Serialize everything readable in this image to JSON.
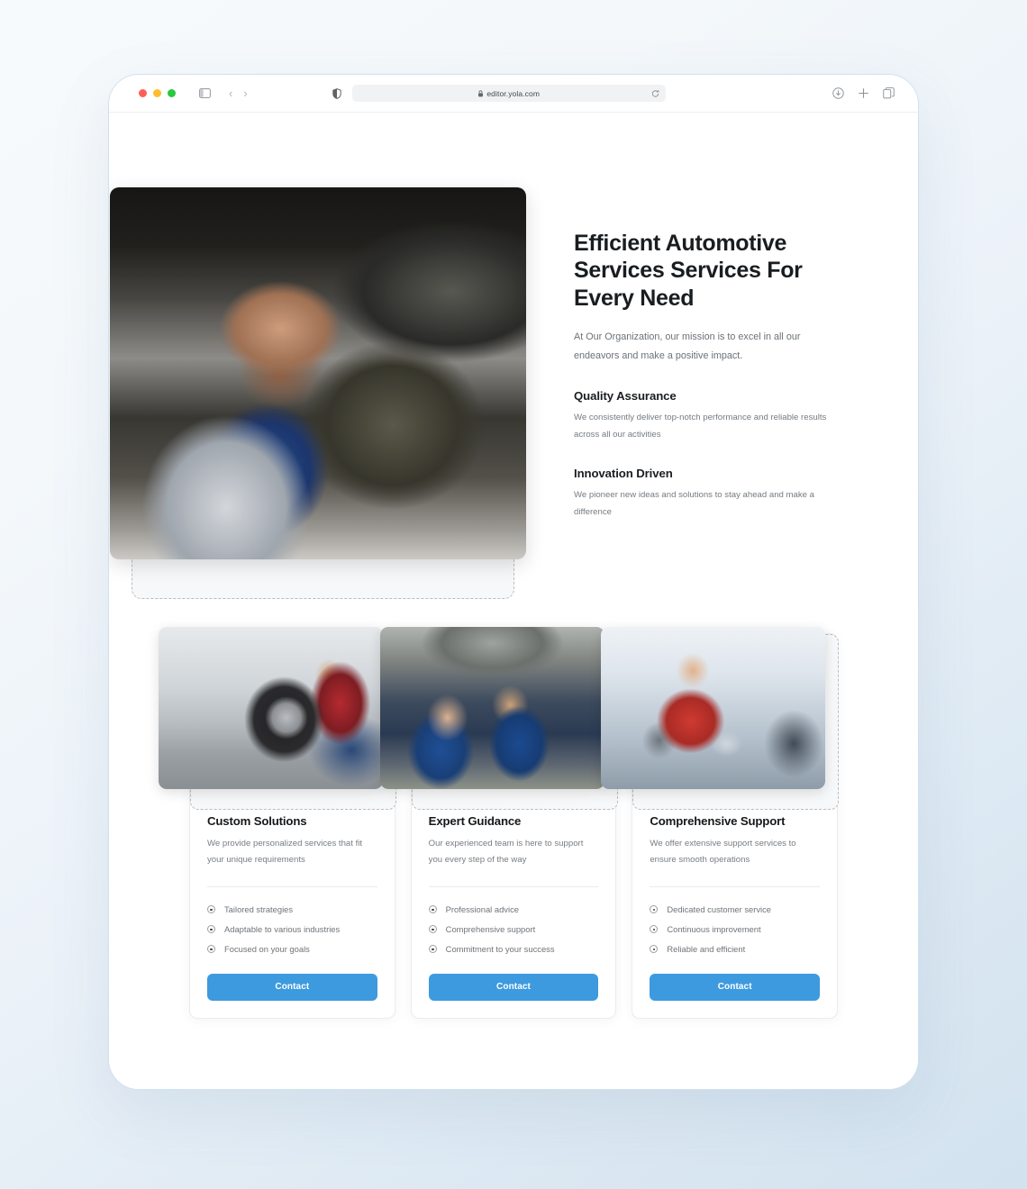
{
  "browser": {
    "url": "editor.yola.com",
    "icons": {
      "sidebar_toggle": "sidebar-toggle-icon",
      "back": "‹",
      "forward": "›",
      "shield": "shield-icon",
      "lock": "lock-icon",
      "reload": "reload-icon",
      "downloads": "download-icon",
      "new_tab": "plus-icon",
      "tabs_overview": "tabs-icon"
    }
  },
  "hero": {
    "title": "Efficient Automotive Services Services For Every Need",
    "subtitle": "At Our Organization, our mission is to excel in all our endeavors and make a positive impact.",
    "image_alt": "mechanic-working-under-car",
    "features": [
      {
        "title": "Quality Assurance",
        "body": "We consistently deliver top-notch performance and reliable results across all our activities"
      },
      {
        "title": "Innovation Driven",
        "body": "We pioneer new ideas and solutions to stay ahead and make a difference"
      }
    ]
  },
  "cards": [
    {
      "image_alt": "technician-changing-tire",
      "title": "Custom Solutions",
      "description": "We provide personalized services that fit your unique requirements",
      "bullets": [
        "Tailored strategies",
        "Adaptable to various industries",
        "Focused on your goals"
      ],
      "button": "Contact"
    },
    {
      "image_alt": "mechanics-inspecting-car-underside",
      "title": "Expert Guidance",
      "description": "Our experienced team is here to support you every step of the way",
      "bullets": [
        "Professional advice",
        "Comprehensive support",
        "Commitment to your success"
      ],
      "button": "Contact"
    },
    {
      "image_alt": "smiling-detailer-cleaning-car",
      "title": "Comprehensive Support",
      "description": "We offer extensive support services to ensure smooth operations",
      "bullets": [
        "Dedicated customer service",
        "Continuous improvement",
        "Reliable and efficient"
      ],
      "button": "Contact"
    }
  ],
  "colors": {
    "accent": "#3d9ade",
    "heading": "#15181b",
    "body_text": "#777d83",
    "frame_border": "#cfe1f1",
    "selection_dash": "#b9bdc2"
  }
}
